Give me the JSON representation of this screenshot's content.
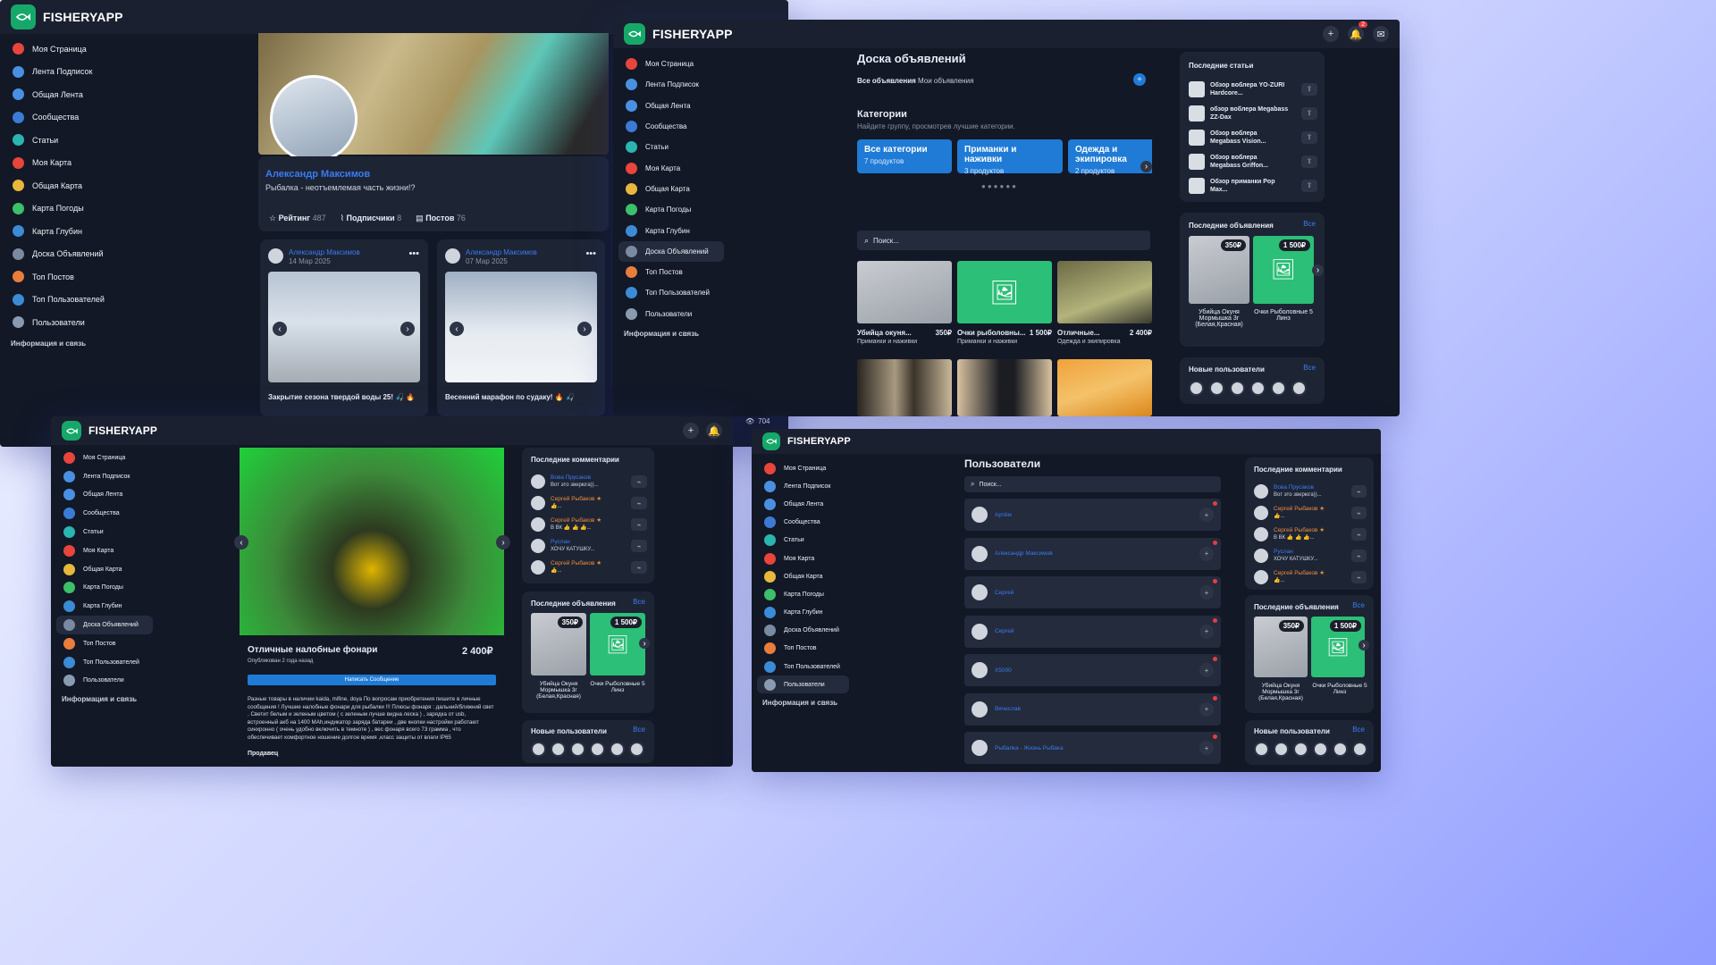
{
  "app": {
    "name": "FISHERYAPP"
  },
  "nav": {
    "items": [
      "Моя Страница",
      "Лента Подписок",
      "Общая Лента",
      "Сообщества",
      "Статьи",
      "Моя Карта",
      "Общая Карта",
      "Карта Погоды",
      "Карта Глубин",
      "Доска Объявлений",
      "Топ Постов",
      "Топ Пользователей",
      "Пользователи"
    ],
    "footer": "Информация и связь",
    "icon_colors": [
      "#e8453c",
      "#4a90e2",
      "#4a90e2",
      "#3b7bd6",
      "#2bb5b0",
      "#e8453c",
      "#e8b83c",
      "#3cc06a",
      "#3b8bd6",
      "#7a8aa0",
      "#e87d3c",
      "#3b8bd6",
      "#8a9ab0"
    ]
  },
  "profile": {
    "name": "Александр Максимов",
    "bio": "Рыбалка - неотъемлемая часть жизни!?",
    "stats": [
      {
        "label": "Рейтинг",
        "value": "487"
      },
      {
        "label": "Подписчики",
        "value": "8"
      },
      {
        "label": "Постов",
        "value": "76"
      }
    ],
    "posts": [
      {
        "author": "Александр Максимов",
        "date": "14 Мар 2025",
        "caption": "Закрытие сезона твердой воды 25! 🎣 🔥"
      },
      {
        "author": "Александр Максимов",
        "date": "07 Мар 2025",
        "caption": "Весенний марафон по судаку! 🔥 🎣"
      }
    ]
  },
  "board": {
    "title": "Доска объявлений",
    "tabs": [
      "Все объявления",
      "Мои объявления"
    ],
    "categories_title": "Категории",
    "categories_sub": "Найдите группу, просмотрев лучшие категории.",
    "categories": [
      {
        "name": "Все категории",
        "count": "7 продуктов"
      },
      {
        "name": "Приманки и наживки",
        "count": "3 продуктов"
      },
      {
        "name": "Одежда и экипировка",
        "count": "2 продуктов"
      }
    ],
    "search_placeholder": "Поиск...",
    "products": [
      {
        "title": "Убийца окуня...",
        "price": "350₽",
        "category": "Приманки и наживки"
      },
      {
        "title": "Очки рыболовны...",
        "price": "1 500₽",
        "category": "Приманки и наживки"
      },
      {
        "title": "Отличные...",
        "price": "2 400₽",
        "category": "Одежда и экипировка"
      }
    ]
  },
  "articles": {
    "title": "Последние статьи",
    "items": [
      "Обзор воблера YO-ZURI Hardcore...",
      "обзор воблера Megabass ZZ-Dax",
      "Обзор воблера Megabass Vision...",
      "Обзор воблера Megabass Griffon...",
      "Обзор приманки Pop Max..."
    ]
  },
  "latest_ads": {
    "title": "Последние объявления",
    "all": "Все",
    "items": [
      {
        "title": "Убийца Окуня Мормышка 3г (Белая,Красная)",
        "price": "350₽"
      },
      {
        "title": "Очки Рыболовные 5 Линз",
        "price": "1 500₽"
      }
    ]
  },
  "new_users": {
    "title": "Новые пользователи",
    "all": "Все"
  },
  "comments": {
    "title": "Последние комментарии",
    "items": [
      {
        "name": "Вова Прусаков",
        "text": "Вот это зверюга))..."
      },
      {
        "name": "Сергей Рыбаков ★",
        "text": "👍..."
      },
      {
        "name": "Сергей Рыбаков ★",
        "text": "В ВК 👍 👍 👍..."
      },
      {
        "name": "Руслан",
        "text": "ХОЧУ КАТУШКУ..."
      },
      {
        "name": "Сергей Рыбаков ★",
        "text": "👍..."
      }
    ]
  },
  "ad_detail": {
    "title": "Отличные налобные фонари",
    "price": "2 400₽",
    "published": "Опубликован 2 года назад",
    "message_btn": "Написать Сообщение",
    "description": "Разные товары в наличии kaida, mifine, doya По вопросам приобретения пишите в личные сообщения ! Лучшие налобные фонари для рыбалки !!! Плюсы фонаря : дальний/ближний свет . Светит белым и зеленым цветом ( с зеленым лучше видна леска ) , зарядка от usb, встроенный акб на 1400 МАh,индикатор заряда батареи , две кнопки настройки работают синхронно ( очень удобно включить в темноте ) , вес фонаря всего 73 грамма , что обеспечивает комфортное ношение долгое время ,класс защиты от влаги IP65",
    "seller_label": "Продавец"
  },
  "users_page": {
    "title": "Пользователи",
    "search_placeholder": "Поиск...",
    "users": [
      "Артём",
      "Александр Максимов",
      "Сергей",
      "Сергей",
      "Х5000",
      "Вячеслав",
      "Рыбалка - Жизнь Рыбака"
    ]
  },
  "counters": {
    "notifications": "2",
    "views": "704"
  },
  "colors": {
    "accent": "#1f7bd6",
    "brand": "#16a86a",
    "bg": "#121826",
    "card": "#1d2535"
  }
}
